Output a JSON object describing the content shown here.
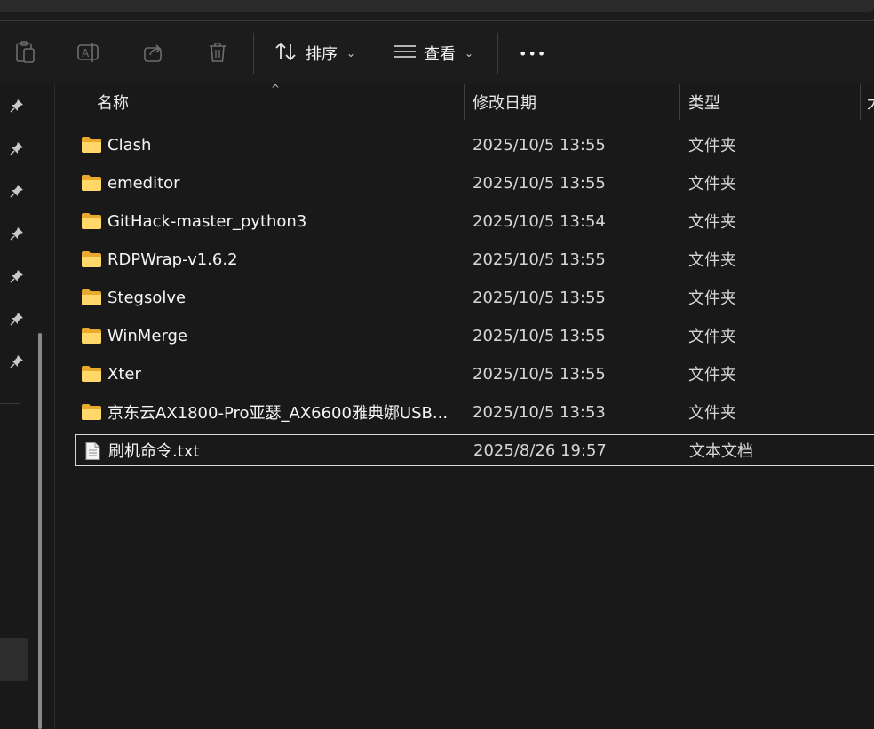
{
  "toolbar": {
    "icons": [
      "paste-icon",
      "rename-icon",
      "share-icon",
      "delete-icon"
    ],
    "sort_label": "排序",
    "view_label": "查看",
    "more_label": "•••"
  },
  "columns": {
    "name": "名称",
    "date": "修改日期",
    "type": "类型",
    "size": "大"
  },
  "files": [
    {
      "name": "Clash",
      "date": "2025/10/5 13:55",
      "type": "文件夹",
      "icon": "folder-icon"
    },
    {
      "name": "emeditor",
      "date": "2025/10/5 13:55",
      "type": "文件夹",
      "icon": "folder-icon"
    },
    {
      "name": "GitHack-master_python3",
      "date": "2025/10/5 13:54",
      "type": "文件夹",
      "icon": "folder-icon"
    },
    {
      "name": "RDPWrap-v1.6.2",
      "date": "2025/10/5 13:55",
      "type": "文件夹",
      "icon": "folder-icon"
    },
    {
      "name": "Stegsolve",
      "date": "2025/10/5 13:55",
      "type": "文件夹",
      "icon": "folder-icon"
    },
    {
      "name": "WinMerge",
      "date": "2025/10/5 13:55",
      "type": "文件夹",
      "icon": "folder-icon"
    },
    {
      "name": "Xter",
      "date": "2025/10/5 13:55",
      "type": "文件夹",
      "icon": "folder-icon"
    },
    {
      "name": "京东云AX1800-Pro亚瑟_AX6600雅典娜USB...",
      "date": "2025/10/5 13:53",
      "type": "文件夹",
      "icon": "folder-icon"
    },
    {
      "name": "刷机命令.txt",
      "date": "2025/8/26 19:57",
      "type": "文本文档",
      "icon": "text-file-icon"
    }
  ]
}
